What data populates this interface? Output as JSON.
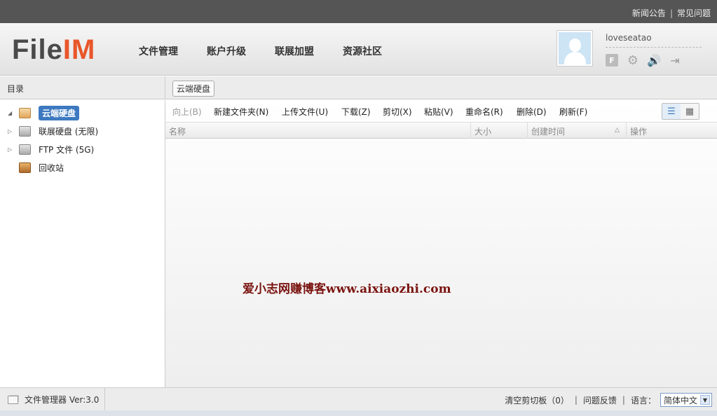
{
  "topbar": {
    "news": "新闻公告",
    "faq": "常见问题",
    "separator": "|"
  },
  "header": {
    "logo_file": "File",
    "logo_im": "IM",
    "nav": [
      "文件管理",
      "账户升级",
      "联展加盟",
      "资源社区"
    ],
    "username": "loveseatao",
    "icons": [
      "f-icon",
      "gear-icon",
      "speaker-icon",
      "exit-icon"
    ]
  },
  "sidebar": {
    "title": "目录",
    "items": [
      {
        "label": "云端硬盘",
        "selected": true,
        "icon": "cloud-drive-icon"
      },
      {
        "label": "联展硬盘 (无限)",
        "selected": false,
        "icon": "drive-icon"
      },
      {
        "label": "FTP 文件 (5G)",
        "selected": false,
        "icon": "ftp-drive-icon"
      },
      {
        "label": "回收站",
        "selected": false,
        "icon": "trash-icon"
      }
    ]
  },
  "main": {
    "tab": "云端硬盘",
    "toolbar": {
      "up": "向上(B)",
      "new_folder": "新建文件夹(N)",
      "upload": "上传文件(U)",
      "download": "下载(Z)",
      "cut": "剪切(X)",
      "paste": "粘贴(V)",
      "rename": "重命名(R)",
      "delete": "删除(D)",
      "refresh": "刷新(F)"
    },
    "columns": {
      "name": "名称",
      "size": "大小",
      "created": "创建时间",
      "actions": "操作"
    },
    "watermark": "爱小志网赚博客www.aixiaozhi.com"
  },
  "statusbar": {
    "app": "文件管理器 Ver:3.0",
    "clear_clipboard": "清空剪切板（0）",
    "feedback": "问题反馈",
    "language_label": "语言：",
    "language_value": "简体中文"
  }
}
